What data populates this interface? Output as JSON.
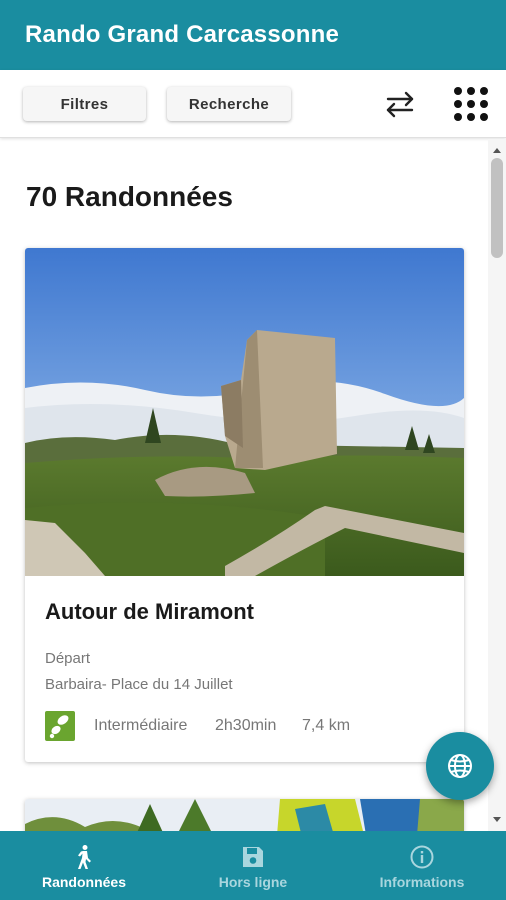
{
  "app": {
    "title": "Rando Grand Carcassonne"
  },
  "toolbar": {
    "filters_label": "Filtres",
    "search_label": "Recherche",
    "swap_icon": "swap-arrows-icon",
    "menu_icon": "grid-apps-icon"
  },
  "list": {
    "heading": "70 Randonnées",
    "hikes": [
      {
        "title": "Autour de Miramont",
        "start_label": "Départ",
        "start_place": "Barbaira- Place du 14 Juillet",
        "level_icon": "hiking-boot-icon",
        "level": "Intermédiaire",
        "duration": "2h30min",
        "distance": "7,4 km"
      }
    ]
  },
  "fab": {
    "icon": "globe-icon"
  },
  "bottom_nav": {
    "items": [
      {
        "label": "Randonnées",
        "icon": "hiker-icon",
        "active": true
      },
      {
        "label": "Hors ligne",
        "icon": "save-icon",
        "active": false
      },
      {
        "label": "Informations",
        "icon": "info-icon",
        "active": false
      }
    ]
  },
  "colors": {
    "primary": "#1a8da0",
    "level_intermediate": "#6aa52f",
    "nav_inactive_text": "#a9d6de"
  }
}
